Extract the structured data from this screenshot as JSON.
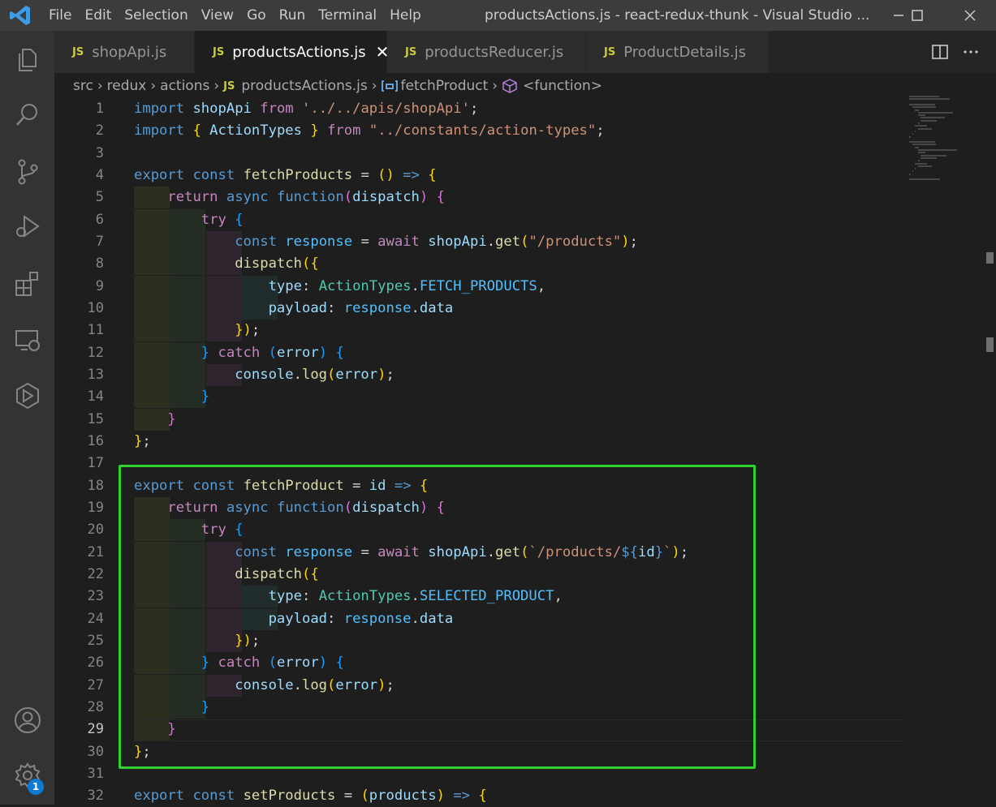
{
  "app": {
    "window_title": "productsActions.js - react-redux-thunk - Visual Studio ...",
    "menu": [
      "File",
      "Edit",
      "Selection",
      "View",
      "Go",
      "Run",
      "Terminal",
      "Help"
    ]
  },
  "activity_bar": {
    "icons": [
      "explorer-icon",
      "search-icon",
      "source-control-icon",
      "run-debug-icon",
      "extensions-icon",
      "remote-explorer-icon",
      "docker-icon"
    ],
    "bottom_icons": [
      "accounts-icon",
      "settings-gear-icon"
    ],
    "settings_badge": "1"
  },
  "tabs": [
    {
      "icon_label": "JS",
      "label": "shopApi.js",
      "active": false
    },
    {
      "icon_label": "JS",
      "label": "productsActions.js",
      "active": true,
      "close": "✕"
    },
    {
      "icon_label": "JS",
      "label": "productsReducer.js",
      "active": false
    },
    {
      "icon_label": "JS",
      "label": "ProductDetails.js",
      "active": false
    }
  ],
  "breadcrumb": {
    "parts": [
      "src",
      "redux",
      "actions"
    ],
    "file_icon": "JS",
    "file": "productsActions.js",
    "symbol": "fetchProduct",
    "inner": "<function>"
  },
  "editor": {
    "current_line": 29,
    "line_numbers": [
      "1",
      "2",
      "3",
      "4",
      "5",
      "6",
      "7",
      "8",
      "9",
      "10",
      "11",
      "12",
      "13",
      "14",
      "15",
      "16",
      "17",
      "18",
      "19",
      "20",
      "21",
      "22",
      "23",
      "24",
      "25",
      "26",
      "27",
      "28",
      "29",
      "30",
      "31",
      "32"
    ],
    "lines": [
      [
        [
          "kw",
          "import"
        ],
        [
          "pl",
          " "
        ],
        [
          "vr",
          "shopApi"
        ],
        [
          "pl",
          " "
        ],
        [
          "ctrl",
          "from"
        ],
        [
          "pl",
          " "
        ],
        [
          "str",
          "'../../apis/shopApi'"
        ],
        [
          "pl",
          ";"
        ]
      ],
      [
        [
          "kw",
          "import"
        ],
        [
          "pl",
          " "
        ],
        [
          "b1",
          "{"
        ],
        [
          "pl",
          " "
        ],
        [
          "vr",
          "ActionTypes"
        ],
        [
          "pl",
          " "
        ],
        [
          "b1",
          "}"
        ],
        [
          "pl",
          " "
        ],
        [
          "ctrl",
          "from"
        ],
        [
          "pl",
          " "
        ],
        [
          "str",
          "\"../constants/action-types\""
        ],
        [
          "pl",
          ";"
        ]
      ],
      [],
      [
        [
          "kw",
          "export"
        ],
        [
          "pl",
          " "
        ],
        [
          "kw",
          "const"
        ],
        [
          "pl",
          " "
        ],
        [
          "fn",
          "fetchProducts"
        ],
        [
          "pl",
          " = "
        ],
        [
          "b1",
          "()"
        ],
        [
          "pl",
          " "
        ],
        [
          "kw",
          "=>"
        ],
        [
          "pl",
          " "
        ],
        [
          "b1",
          "{"
        ]
      ],
      [
        [
          "pl",
          "    "
        ],
        [
          "ctrl",
          "return"
        ],
        [
          "pl",
          " "
        ],
        [
          "kw",
          "async"
        ],
        [
          "pl",
          " "
        ],
        [
          "kw",
          "function"
        ],
        [
          "b2",
          "("
        ],
        [
          "vr",
          "dispatch"
        ],
        [
          "b2",
          ")"
        ],
        [
          "pl",
          " "
        ],
        [
          "b2",
          "{"
        ]
      ],
      [
        [
          "pl",
          "        "
        ],
        [
          "ctrl",
          "try"
        ],
        [
          "pl",
          " "
        ],
        [
          "b3",
          "{"
        ]
      ],
      [
        [
          "pl",
          "            "
        ],
        [
          "kw",
          "const"
        ],
        [
          "pl",
          " "
        ],
        [
          "cn",
          "response"
        ],
        [
          "pl",
          " = "
        ],
        [
          "ctrl",
          "await"
        ],
        [
          "pl",
          " "
        ],
        [
          "vr",
          "shopApi"
        ],
        [
          "pl",
          "."
        ],
        [
          "fn",
          "get"
        ],
        [
          "b1",
          "("
        ],
        [
          "str",
          "\"/products\""
        ],
        [
          "b1",
          ")"
        ],
        [
          "pl",
          ";"
        ]
      ],
      [
        [
          "pl",
          "            "
        ],
        [
          "fn",
          "dispatch"
        ],
        [
          "b1",
          "({"
        ]
      ],
      [
        [
          "pl",
          "                "
        ],
        [
          "vr",
          "type"
        ],
        [
          "pl",
          ": "
        ],
        [
          "ty",
          "ActionTypes"
        ],
        [
          "pl",
          "."
        ],
        [
          "cn",
          "FETCH_PRODUCTS"
        ],
        [
          "pl",
          ","
        ]
      ],
      [
        [
          "pl",
          "                "
        ],
        [
          "vr",
          "payload"
        ],
        [
          "pl",
          ": "
        ],
        [
          "cn",
          "response"
        ],
        [
          "pl",
          "."
        ],
        [
          "vr",
          "data"
        ]
      ],
      [
        [
          "pl",
          "            "
        ],
        [
          "b1",
          "})"
        ],
        [
          "pl",
          ";"
        ]
      ],
      [
        [
          "pl",
          "        "
        ],
        [
          "b3",
          "}"
        ],
        [
          "pl",
          " "
        ],
        [
          "ctrl",
          "catch"
        ],
        [
          "pl",
          " "
        ],
        [
          "b3",
          "("
        ],
        [
          "vr",
          "error"
        ],
        [
          "b3",
          ")"
        ],
        [
          "pl",
          " "
        ],
        [
          "b3",
          "{"
        ]
      ],
      [
        [
          "pl",
          "            "
        ],
        [
          "vr",
          "console"
        ],
        [
          "pl",
          "."
        ],
        [
          "fn",
          "log"
        ],
        [
          "b1",
          "("
        ],
        [
          "vr",
          "error"
        ],
        [
          "b1",
          ")"
        ],
        [
          "pl",
          ";"
        ]
      ],
      [
        [
          "pl",
          "        "
        ],
        [
          "b3",
          "}"
        ]
      ],
      [
        [
          "pl",
          "    "
        ],
        [
          "b2",
          "}"
        ]
      ],
      [
        [
          "b1",
          "}"
        ],
        [
          "pl",
          ";"
        ]
      ],
      [],
      [
        [
          "kw",
          "export"
        ],
        [
          "pl",
          " "
        ],
        [
          "kw",
          "const"
        ],
        [
          "pl",
          " "
        ],
        [
          "fn",
          "fetchProduct"
        ],
        [
          "pl",
          " = "
        ],
        [
          "vr",
          "id"
        ],
        [
          "pl",
          " "
        ],
        [
          "kw",
          "=>"
        ],
        [
          "pl",
          " "
        ],
        [
          "b1",
          "{"
        ]
      ],
      [
        [
          "pl",
          "    "
        ],
        [
          "ctrl",
          "return"
        ],
        [
          "pl",
          " "
        ],
        [
          "kw",
          "async"
        ],
        [
          "pl",
          " "
        ],
        [
          "kw",
          "function"
        ],
        [
          "b2",
          "("
        ],
        [
          "vr",
          "dispatch"
        ],
        [
          "b2",
          ")"
        ],
        [
          "pl",
          " "
        ],
        [
          "b2",
          "{"
        ]
      ],
      [
        [
          "pl",
          "        "
        ],
        [
          "ctrl",
          "try"
        ],
        [
          "pl",
          " "
        ],
        [
          "b3",
          "{"
        ]
      ],
      [
        [
          "pl",
          "            "
        ],
        [
          "kw",
          "const"
        ],
        [
          "pl",
          " "
        ],
        [
          "cn",
          "response"
        ],
        [
          "pl",
          " = "
        ],
        [
          "ctrl",
          "await"
        ],
        [
          "pl",
          " "
        ],
        [
          "vr",
          "shopApi"
        ],
        [
          "pl",
          "."
        ],
        [
          "fn",
          "get"
        ],
        [
          "b1",
          "("
        ],
        [
          "str",
          "`/products/"
        ],
        [
          "kw",
          "${"
        ],
        [
          "vr",
          "id"
        ],
        [
          "kw",
          "}"
        ],
        [
          "str",
          "`"
        ],
        [
          "b1",
          ")"
        ],
        [
          "pl",
          ";"
        ]
      ],
      [
        [
          "pl",
          "            "
        ],
        [
          "fn",
          "dispatch"
        ],
        [
          "b1",
          "({"
        ]
      ],
      [
        [
          "pl",
          "                "
        ],
        [
          "vr",
          "type"
        ],
        [
          "pl",
          ": "
        ],
        [
          "ty",
          "ActionTypes"
        ],
        [
          "pl",
          "."
        ],
        [
          "cn",
          "SELECTED_PRODUCT"
        ],
        [
          "pl",
          ","
        ]
      ],
      [
        [
          "pl",
          "                "
        ],
        [
          "vr",
          "payload"
        ],
        [
          "pl",
          ": "
        ],
        [
          "cn",
          "response"
        ],
        [
          "pl",
          "."
        ],
        [
          "vr",
          "data"
        ]
      ],
      [
        [
          "pl",
          "            "
        ],
        [
          "b1",
          "})"
        ],
        [
          "pl",
          ";"
        ]
      ],
      [
        [
          "pl",
          "        "
        ],
        [
          "b3",
          "}"
        ],
        [
          "pl",
          " "
        ],
        [
          "ctrl",
          "catch"
        ],
        [
          "pl",
          " "
        ],
        [
          "b3",
          "("
        ],
        [
          "vr",
          "error"
        ],
        [
          "b3",
          ")"
        ],
        [
          "pl",
          " "
        ],
        [
          "b3",
          "{"
        ]
      ],
      [
        [
          "pl",
          "            "
        ],
        [
          "vr",
          "console"
        ],
        [
          "pl",
          "."
        ],
        [
          "fn",
          "log"
        ],
        [
          "b1",
          "("
        ],
        [
          "vr",
          "error"
        ],
        [
          "b1",
          ")"
        ],
        [
          "pl",
          ";"
        ]
      ],
      [
        [
          "pl",
          "        "
        ],
        [
          "b3",
          "}"
        ]
      ],
      [
        [
          "pl",
          "    "
        ],
        [
          "b2",
          "}"
        ]
      ],
      [
        [
          "b1",
          "}"
        ],
        [
          "pl",
          ";"
        ]
      ],
      [],
      [
        [
          "kw",
          "export"
        ],
        [
          "pl",
          " "
        ],
        [
          "kw",
          "const"
        ],
        [
          "pl",
          " "
        ],
        [
          "fn",
          "setProducts"
        ],
        [
          "pl",
          " = "
        ],
        [
          "b1",
          "("
        ],
        [
          "vr",
          "products"
        ],
        [
          "b1",
          ")"
        ],
        [
          "pl",
          " "
        ],
        [
          "kw",
          "=>"
        ],
        [
          "pl",
          " "
        ],
        [
          "b1",
          "{"
        ]
      ]
    ]
  },
  "colors": {
    "highlight_box": "#2fd12f",
    "vscode_blue": "#0e7ad3"
  }
}
